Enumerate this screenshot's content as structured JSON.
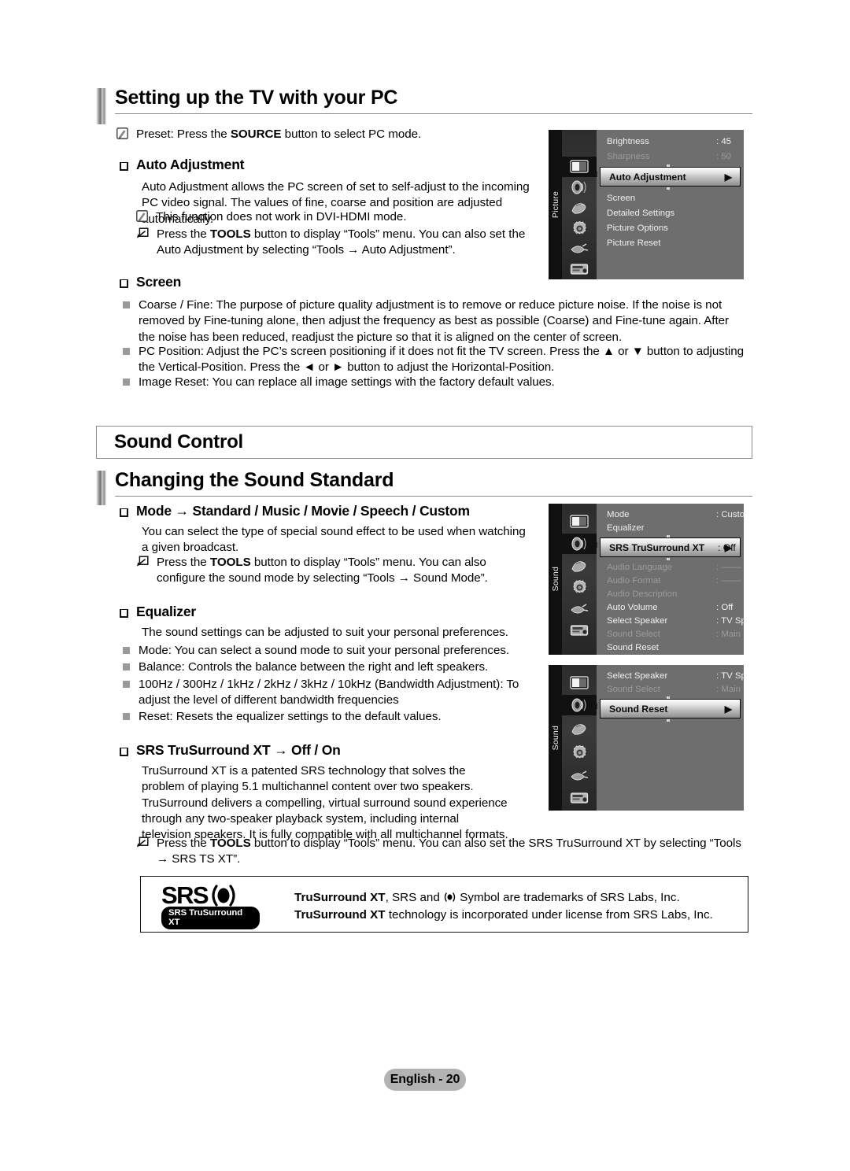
{
  "page": {
    "footer_label": "English - 20"
  },
  "section1": {
    "heading": "Setting up the TV with your PC",
    "preset_note": "Preset: Press the SOURCE button to select PC mode.",
    "preset_note_bold": "SOURCE",
    "auto_adjustment": {
      "title": "Auto Adjustment",
      "body": "Auto Adjustment allows the PC screen of set to self-adjust to the incoming PC video signal. The values of fine, coarse and position are adjusted automatically.",
      "note1": "This function does not work in DVI-HDMI mode.",
      "note2_pre": "Press the ",
      "note2_bold": "TOOLS",
      "note2_post": " button to display “Tools” menu. You can also set the Auto Adjustment by selecting “Tools → Auto Adjustment”."
    },
    "screen": {
      "title": "Screen",
      "items": [
        "Coarse / Fine: The purpose of picture quality adjustment is to remove or reduce picture noise. If the noise is not removed by Fine-tuning alone, then adjust the frequency as best as possible (Coarse) and Fine-tune again. After the noise has been reduced, readjust the picture so that it is aligned on the center of screen.",
        "PC Position: Adjust the PC’s screen positioning if it does not fit the TV screen. Press the ▲ or ▼ button to adjusting the Vertical-Position. Press the ◄ or ► button to adjust the Horizontal-Position.",
        "Image Reset: You can replace all image settings with the factory default values."
      ]
    }
  },
  "section2": {
    "box_title": "Sound Control",
    "heading": "Changing the Sound Standard",
    "mode": {
      "title": "Mode → Standard / Music / Movie / Speech / Custom",
      "body": "You can select the type of special sound effect to be used when watching a given broadcast.",
      "note_pre": "Press the ",
      "note_bold": "TOOLS",
      "note_post": " button to display “Tools” menu. You can also configure the sound mode by selecting “Tools → Sound Mode”."
    },
    "equalizer": {
      "title": "Equalizer",
      "body": "The sound settings can be adjusted to suit your personal preferences.",
      "items": [
        "Mode: You can select a sound mode to suit your personal preferences.",
        "Balance: Controls the balance between the right and left speakers.",
        "100Hz / 300Hz / 1kHz / 2kHz / 3kHz / 10kHz (Bandwidth Adjustment): To adjust the level of different bandwidth frequencies",
        "Reset: Resets the equalizer settings to the default values."
      ]
    },
    "srs": {
      "title": "SRS TruSurround XT → Off / On",
      "body": "TruSurround XT is a patented SRS technology that solves the problem of playing 5.1 multichannel content over two speakers. TruSurround delivers a compelling, virtual surround sound experience through any two-speaker playback system, including internal television speakers. It is fully compatible with all multichannel formats.",
      "note_pre": "Press the ",
      "note_bold": "TOOLS",
      "note_post": " button to display “Tools” menu. You can also set the SRS TruSurround XT by selecting “Tools → SRS TS XT”."
    }
  },
  "trademark": {
    "logo_word": "SRS",
    "logo_pill": "SRS TruSurround XT",
    "text_part1_bold": "TruSurround XT",
    "text_part2": ", SRS and ",
    "text_part3": " Symbol are trademarks of SRS Labs, Inc. ",
    "text_part4_bold": "TruSurround XT",
    "text_part5": " technology is incorporated under license from SRS Labs, Inc."
  },
  "osd_picture": {
    "rail_label": "Picture",
    "icons": [
      "picture-icon",
      "sound-icon",
      "channel-icon",
      "setup-icon",
      "input-icon",
      "support-icon"
    ],
    "selected_icon_index": 0,
    "rows_above": [
      {
        "name": "Brightness",
        "value": ": 45",
        "dim": false
      },
      {
        "name": "Sharpness",
        "value": ": 50",
        "dim": true
      }
    ],
    "highlight": {
      "name": "Auto Adjustment",
      "value": "",
      "arrow": "▶"
    },
    "rows_below": [
      {
        "name": "Screen",
        "value": "",
        "dim": false
      },
      {
        "name": "Detailed Settings",
        "value": "",
        "dim": false
      },
      {
        "name": "Picture Options",
        "value": "",
        "dim": false
      },
      {
        "name": "Picture Reset",
        "value": "",
        "dim": false
      }
    ]
  },
  "osd_sound1": {
    "rail_label": "Sound",
    "icons": [
      "picture-icon",
      "sound-icon",
      "channel-icon",
      "setup-icon",
      "input-icon",
      "support-icon"
    ],
    "selected_icon_index": 1,
    "rows_above": [
      {
        "name": "Mode",
        "value": ": Custom",
        "dim": false
      },
      {
        "name": "Equalizer",
        "value": "",
        "dim": false
      }
    ],
    "highlight": {
      "name": "SRS TruSurround XT",
      "value": ": Off",
      "arrow": "▶"
    },
    "rows_below": [
      {
        "name": "Audio Language",
        "value": ": ––––",
        "dim": true
      },
      {
        "name": "Audio Format",
        "value": ": ––––",
        "dim": true
      },
      {
        "name": "Audio Description",
        "value": "",
        "dim": true
      },
      {
        "name": "Auto Volume",
        "value": ": Off",
        "dim": false
      },
      {
        "name": "Select Speaker",
        "value": ": TV Speaker",
        "dim": false
      },
      {
        "name": "Sound Select",
        "value": ": Main",
        "dim": true
      },
      {
        "name": "Sound Reset",
        "value": "",
        "dim": false
      }
    ]
  },
  "osd_sound2": {
    "rail_label": "Sound",
    "icons": [
      "picture-icon",
      "sound-icon",
      "channel-icon",
      "setup-icon",
      "input-icon",
      "support-icon"
    ],
    "selected_icon_index": 1,
    "rows_above": [
      {
        "name": "Select Speaker",
        "value": ": TV Speaker",
        "dim": false
      },
      {
        "name": "Sound Select",
        "value": ": Main",
        "dim": true
      }
    ],
    "highlight": {
      "name": "Sound Reset",
      "value": "",
      "arrow": "▶"
    },
    "rows_below": []
  }
}
